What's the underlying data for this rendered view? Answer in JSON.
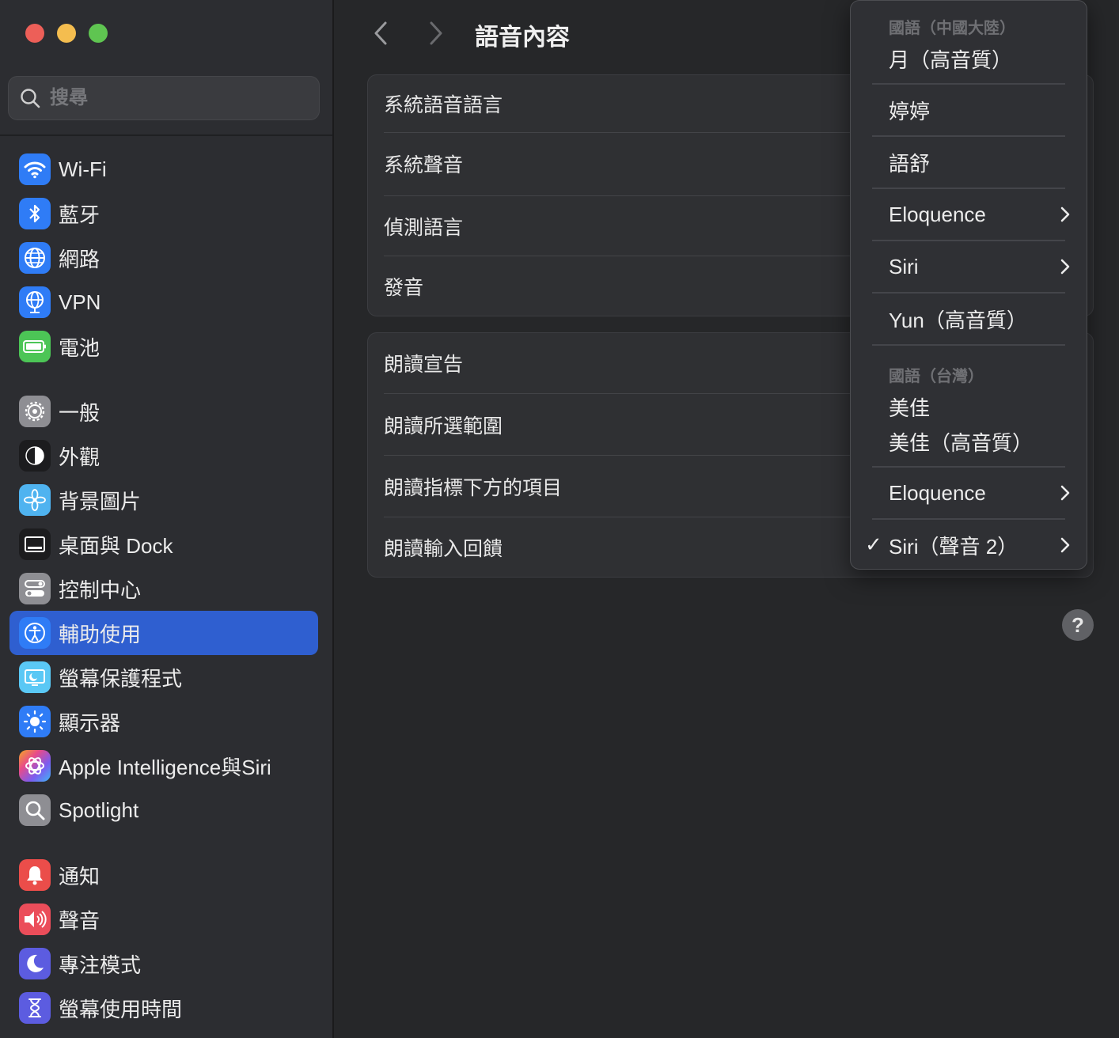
{
  "sidebar": {
    "search_placeholder": "搜尋",
    "items": [
      {
        "label": "Wi-Fi",
        "icon": "wifi-icon",
        "color": "#2f7cf6"
      },
      {
        "label": "藍牙",
        "icon": "bluetooth-icon",
        "color": "#2f7cf6"
      },
      {
        "label": "網路",
        "icon": "globe-icon",
        "color": "#2f7cf6"
      },
      {
        "label": "VPN",
        "icon": "vpn-globe-icon",
        "color": "#2f7cf6"
      },
      {
        "label": "電池",
        "icon": "battery-icon",
        "color": "#4cc556"
      },
      {
        "label": "一般",
        "icon": "gear-icon",
        "color": "#8e8e93"
      },
      {
        "label": "外觀",
        "icon": "appearance-icon",
        "color": "#1c1c1e"
      },
      {
        "label": "背景圖片",
        "icon": "flower-icon",
        "color": "#4fb3f0"
      },
      {
        "label": "桌面與 Dock",
        "icon": "dock-icon",
        "color": "#1c1c1e"
      },
      {
        "label": "控制中心",
        "icon": "toggles-icon",
        "color": "#8e8e93"
      },
      {
        "label": "輔助使用",
        "icon": "accessibility-icon",
        "color": "#2f7cf6"
      },
      {
        "label": "螢幕保護程式",
        "icon": "screensaver-icon",
        "color": "#5ac8f5"
      },
      {
        "label": "顯示器",
        "icon": "sun-icon",
        "color": "#2f7cf6"
      },
      {
        "label": "Apple Intelligence與Siri",
        "icon": "apple-intelligence-icon",
        "color": "#c05be0"
      },
      {
        "label": "Spotlight",
        "icon": "magnifier-icon",
        "color": "#8e8e93"
      },
      {
        "label": "通知",
        "icon": "bell-icon",
        "color": "#eb4d4a"
      },
      {
        "label": "聲音",
        "icon": "speaker-icon",
        "color": "#eb4d5a"
      },
      {
        "label": "專注模式",
        "icon": "moon-icon",
        "color": "#5c5ce0"
      },
      {
        "label": "螢幕使用時間",
        "icon": "hourglass-icon",
        "color": "#5c5ce0"
      }
    ],
    "selected_index": 10
  },
  "main": {
    "title": "語音內容",
    "group1": [
      "系統語音語言",
      "系統聲音",
      "偵測語言",
      "發音"
    ],
    "group2": [
      "朗讀宣告",
      "朗讀所選範圍",
      "朗讀指標下方的項目",
      "朗讀輸入回饋"
    ],
    "help_label": "?"
  },
  "menu": {
    "header_cn": "國語（中國大陸）",
    "item_yue": "月（高音質）",
    "item_tingting": "婷婷",
    "item_yushu": "語舒",
    "item_eloquence1": "Eloquence",
    "item_siri": "Siri",
    "item_yun": "Yun（高音質）",
    "header_tw": "國語（台灣）",
    "item_meijia": "美佳",
    "item_meijia_hq": "美佳（高音質）",
    "item_eloquence2": "Eloquence",
    "item_siri2": "Siri（聲音 2）",
    "checkmark": "✓"
  }
}
